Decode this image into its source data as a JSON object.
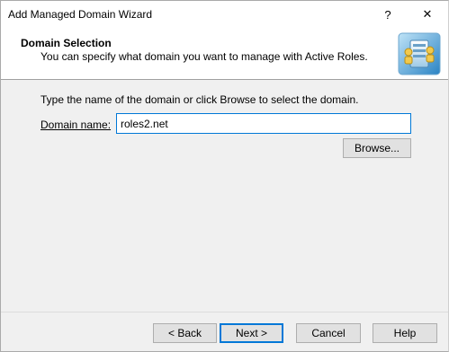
{
  "window": {
    "title": "Add Managed Domain Wizard",
    "help_glyph": "?",
    "close_glyph": "✕"
  },
  "header": {
    "title": "Domain Selection",
    "subtitle": "You can specify what domain you want to manage with Active Roles.",
    "icon": "wizard-server-icon"
  },
  "main": {
    "instruction": "Type the name of the domain or click Browse to select the domain.",
    "domain_label": "Domain name:",
    "domain_value": "roles2.net",
    "browse_label": "Browse..."
  },
  "footer": {
    "back_label": "< Back",
    "next_label": "Next >",
    "cancel_label": "Cancel",
    "help_label": "Help"
  },
  "colors": {
    "accent": "#0078d7",
    "dialog_bg": "#f0f0f0",
    "button_bg": "#e1e1e1"
  }
}
